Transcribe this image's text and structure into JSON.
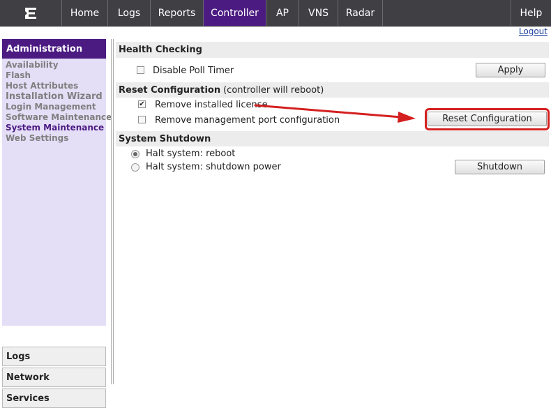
{
  "nav": {
    "logo_icon": "extreme-networks-logo",
    "tabs": [
      "Home",
      "Logs",
      "Reports",
      "Controller",
      "AP",
      "VNS",
      "Radar"
    ],
    "active_tab": "Controller",
    "help": "Help"
  },
  "logout": "Logout",
  "sidebar": {
    "header": "Administration",
    "links": [
      "Availability",
      "Flash",
      "Host Attributes",
      "Installation Wizard",
      "Login Management",
      "Software Maintenance",
      "System Maintenance",
      "Web Settings"
    ],
    "current_link": "System Maintenance",
    "sections": [
      "Logs",
      "Network",
      "Services"
    ]
  },
  "health": {
    "title": "Health Checking",
    "disable_poll": {
      "label": "Disable Poll Timer",
      "checked": false
    },
    "apply_label": "Apply"
  },
  "reset": {
    "title": "Reset Configuration",
    "note": "(controller will reboot)",
    "remove_license": {
      "label": "Remove installed license",
      "checked": true
    },
    "remove_mgmt": {
      "label": "Remove management port configuration",
      "checked": false
    },
    "button_label": "Reset Configuration"
  },
  "shutdown": {
    "title": "System Shutdown",
    "option_reboot": {
      "label": "Halt system: reboot",
      "selected": true
    },
    "option_power": {
      "label": "Halt system: shutdown power",
      "selected": false
    },
    "button_label": "Shutdown"
  },
  "colors": {
    "brand_purple": "#4b1b82",
    "nav_bg": "#3f3f44",
    "sidebar_bg": "#e4def7",
    "annotation_red": "#d42020"
  }
}
